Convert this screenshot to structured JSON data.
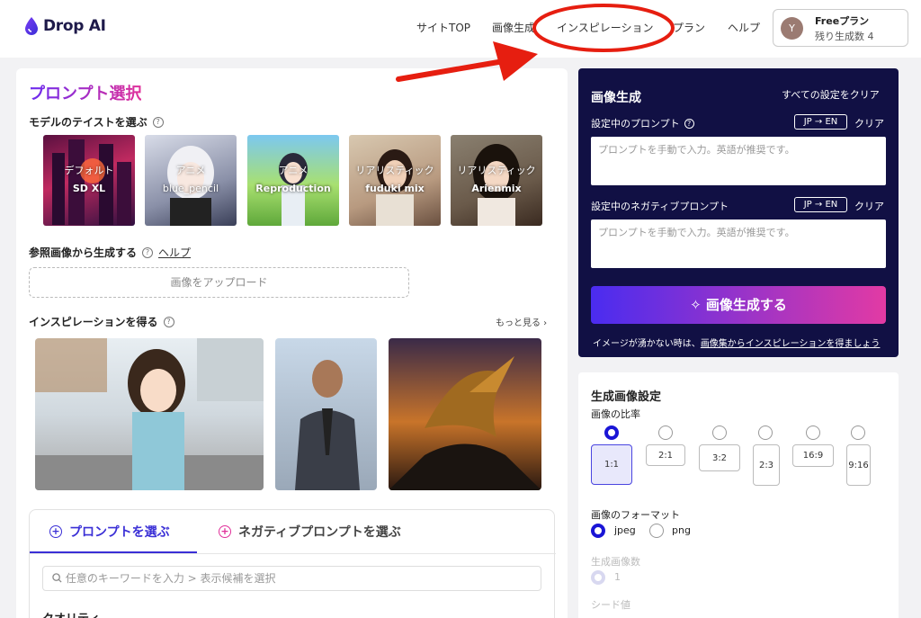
{
  "brand": {
    "name": "Drop AI",
    "accent": "#3a2fd6",
    "accent_pink": "#e0309a",
    "dark_panel": "#111044"
  },
  "header": {
    "nav": [
      "サイトTOP",
      "画像生成",
      "インスピレーション",
      "プラン",
      "ヘルプ"
    ],
    "plan": {
      "avatar": "Y",
      "name": "Freeプラン",
      "remaining": "残り生成数 4"
    }
  },
  "left": {
    "title": "プロンプト選択",
    "model_section": "モデルのテイストを選ぶ",
    "models": [
      {
        "line1": "デフォルト",
        "line2": "SD XL"
      },
      {
        "line1": "アニメ",
        "line2": "blue_pencil"
      },
      {
        "line1": "アニメ",
        "line2": "Reproduction"
      },
      {
        "line1": "リアリスティック",
        "line2": "fuduki mix"
      },
      {
        "line1": "リアリスティック",
        "line2": "Arienmix"
      }
    ],
    "reference_section": "参照画像から生成する",
    "help_link": "ヘルプ",
    "upload_label": "画像をアップロード",
    "inspiration_section": "インスピレーションを得る",
    "more_link": "もっと見る ›",
    "prompt_tabs": [
      "プロンプトを選ぶ",
      "ネガティブプロンプトを選ぶ"
    ],
    "search_placeholder": "任意のキーワードを入力 > 表示候補を選択",
    "quality_label": "クオリティ"
  },
  "generate": {
    "title": "画像生成",
    "clear_all": "すべての設定をクリア",
    "prompt_label": "設定中のプロンプト",
    "negative_label": "設定中のネガティブプロンプト",
    "translate": "JP → EN",
    "clear": "クリア",
    "placeholder": "プロンプトを手動で入力。英語が推奨です。",
    "button": "✧ 画像生成する",
    "footer_prefix": "イメージが湧かない時は、",
    "footer_link": "画像集からインスピレーションを得ましょう"
  },
  "settings": {
    "title": "生成画像設定",
    "ratio_label": "画像の比率",
    "ratios": [
      "1:1",
      "2:1",
      "3:2",
      "2:3",
      "16:9",
      "9:16"
    ],
    "selected_ratio": "1:1",
    "format_label": "画像のフォーマット",
    "formats": [
      "jpeg",
      "png"
    ],
    "selected_format": "jpeg",
    "count_label": "生成画像数",
    "count_value": "1",
    "seed_label": "シード値"
  }
}
